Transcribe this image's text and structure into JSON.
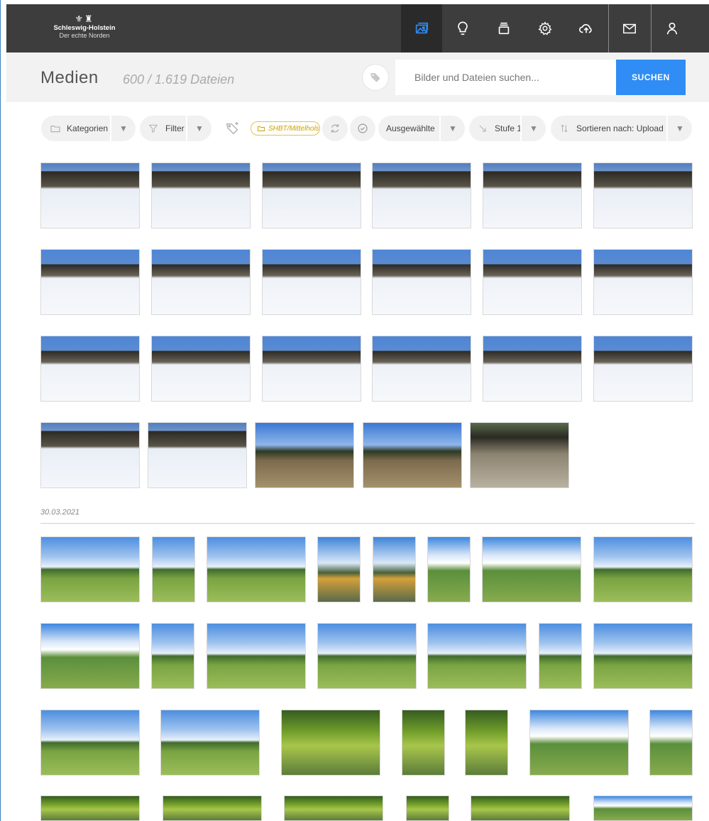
{
  "brand": {
    "crest": "⚜♜",
    "name": "Schleswig-Holstein",
    "tagline": "Der echte Norden"
  },
  "nav": {
    "items": [
      {
        "name": "media-nav-button",
        "icon": "images-icon"
      },
      {
        "name": "ideas-nav-button",
        "icon": "lightbulb-icon"
      },
      {
        "name": "collections-nav-button",
        "icon": "stack-icon"
      },
      {
        "name": "settings-nav-button",
        "icon": "gear-icon"
      },
      {
        "name": "upload-nav-button",
        "icon": "cloud-upload-icon"
      },
      {
        "name": "messages-nav-button",
        "icon": "envelope-icon"
      },
      {
        "name": "account-nav-button",
        "icon": "user-icon"
      }
    ],
    "active_color": "#2f8df5"
  },
  "header": {
    "title": "Medien",
    "count": "600 / 1.619 Dateien",
    "search_placeholder": "Bilder und Dateien suchen...",
    "search_button": "SUCHEN"
  },
  "toolbar": {
    "categories": "Kategorien",
    "filter": "Filter",
    "path": "SHBT/Mittelholstein",
    "selected": "Ausgewählte",
    "level": "Stufe 1",
    "sort": "Sortieren nach: Upload"
  },
  "sections": [
    {
      "date": "30.03.2021"
    }
  ],
  "colors": {
    "nav_bg": "#3d3d3d",
    "accent": "#2f8df5",
    "chip": "#c9a000",
    "snow": "#eef2f8",
    "sky": "#2f7fd8",
    "grass": "#8fb04a"
  }
}
